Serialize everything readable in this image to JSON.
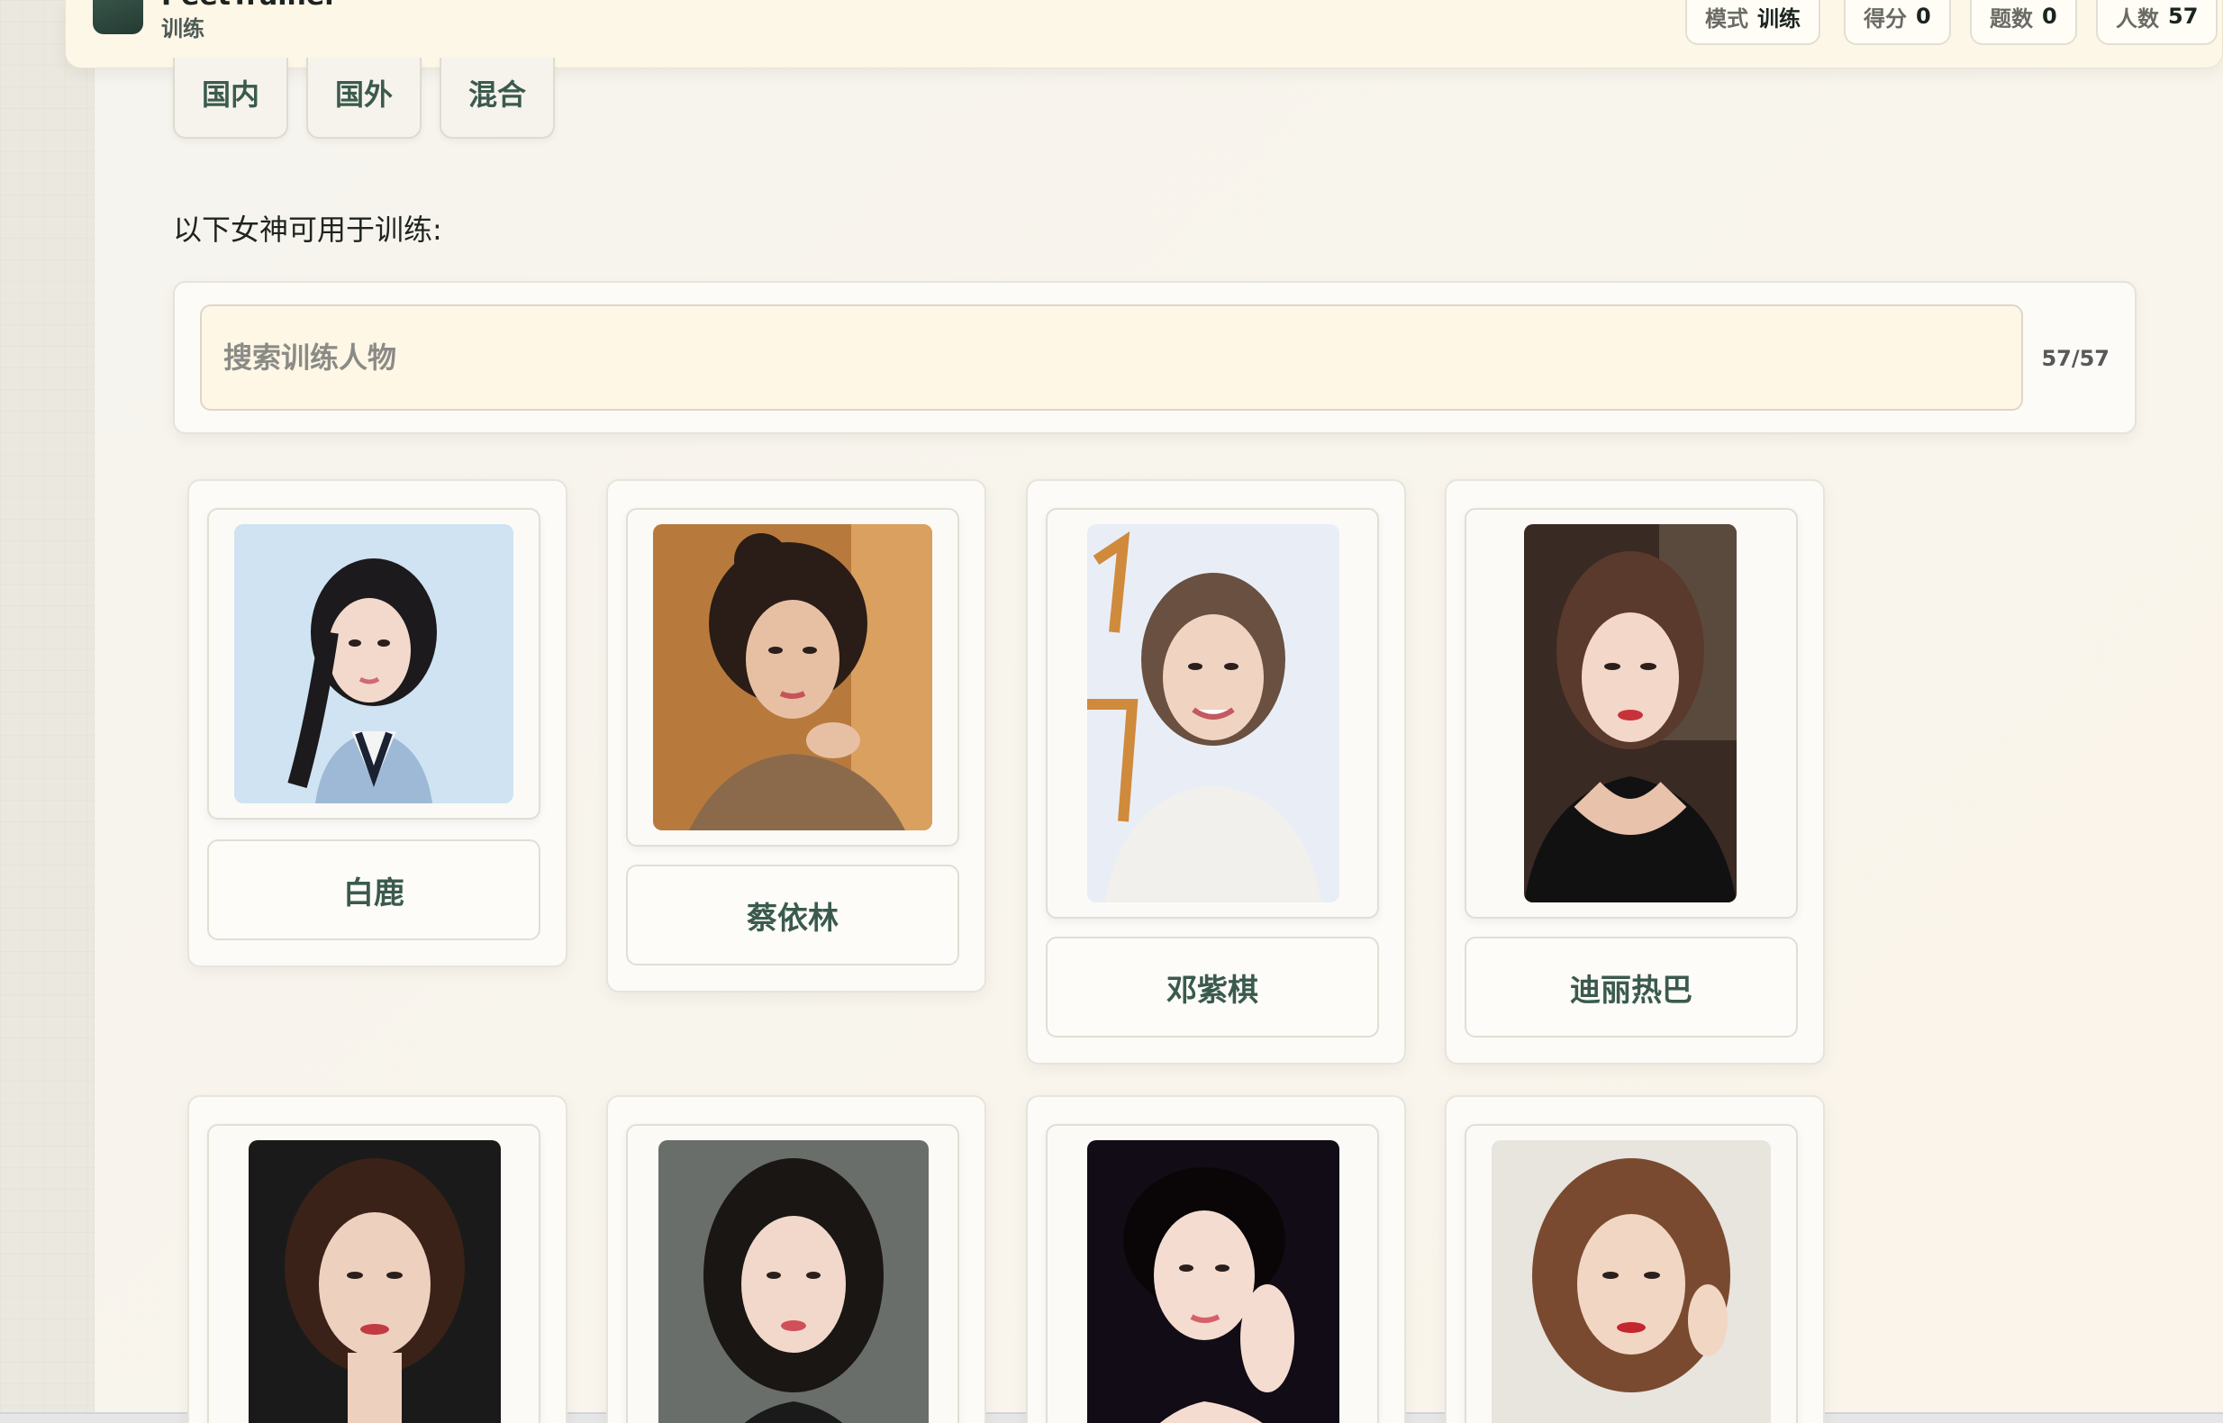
{
  "header": {
    "brand_name": "PeetTrainer",
    "brand_sub": "训练",
    "stats": [
      {
        "key": "模式",
        "value": "训练"
      },
      {
        "key": "得分",
        "value": "0"
      },
      {
        "key": "题数",
        "value": "0"
      },
      {
        "key": "人数",
        "value": "57"
      }
    ]
  },
  "tabs": [
    {
      "label": "国内"
    },
    {
      "label": "国外"
    },
    {
      "label": "混合"
    }
  ],
  "section_label": "以下女神可用于训练:",
  "search": {
    "placeholder": "搜索训练人物",
    "value": "",
    "count": "57/57"
  },
  "cards": [
    {
      "name": "白鹿"
    },
    {
      "name": "蔡依林"
    },
    {
      "name": "邓紫棋"
    },
    {
      "name": "迪丽热巴"
    },
    {
      "name": ""
    },
    {
      "name": ""
    },
    {
      "name": ""
    },
    {
      "name": ""
    }
  ],
  "colors": {
    "accent": "#3b5a4e",
    "header_bg": "#fdf7e8",
    "search_bg": "#fef7e6"
  }
}
